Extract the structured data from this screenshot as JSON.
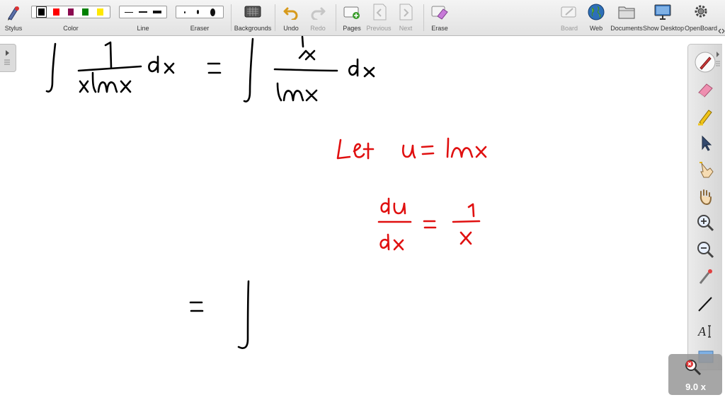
{
  "toolbar": {
    "stylus": "Stylus",
    "color": "Color",
    "line": "Line",
    "eraser": "Eraser",
    "backgrounds": "Backgrounds",
    "undo": "Undo",
    "redo": "Redo",
    "pages": "Pages",
    "previous": "Previous",
    "next": "Next",
    "erase": "Erase",
    "board": "Board",
    "web": "Web",
    "documents": "Documents",
    "show_desktop": "Show Desktop",
    "openboard": "OpenBoard"
  },
  "colors": {
    "palette": [
      "#000000",
      "#ff0000",
      "#8b0a50",
      "#008000",
      "#ffe800"
    ],
    "ink_black": "#000000",
    "ink_red": "#e01010"
  },
  "dock_tools": [
    "pen-icon",
    "eraser-icon",
    "highlighter-icon",
    "select-arrow-icon",
    "interact-hand-icon",
    "pan-hand-icon",
    "zoom-in-icon",
    "zoom-out-icon",
    "laser-pointer-icon",
    "line-icon",
    "text-icon",
    "capture-icon"
  ],
  "zoom": {
    "value": "9.0 x"
  }
}
